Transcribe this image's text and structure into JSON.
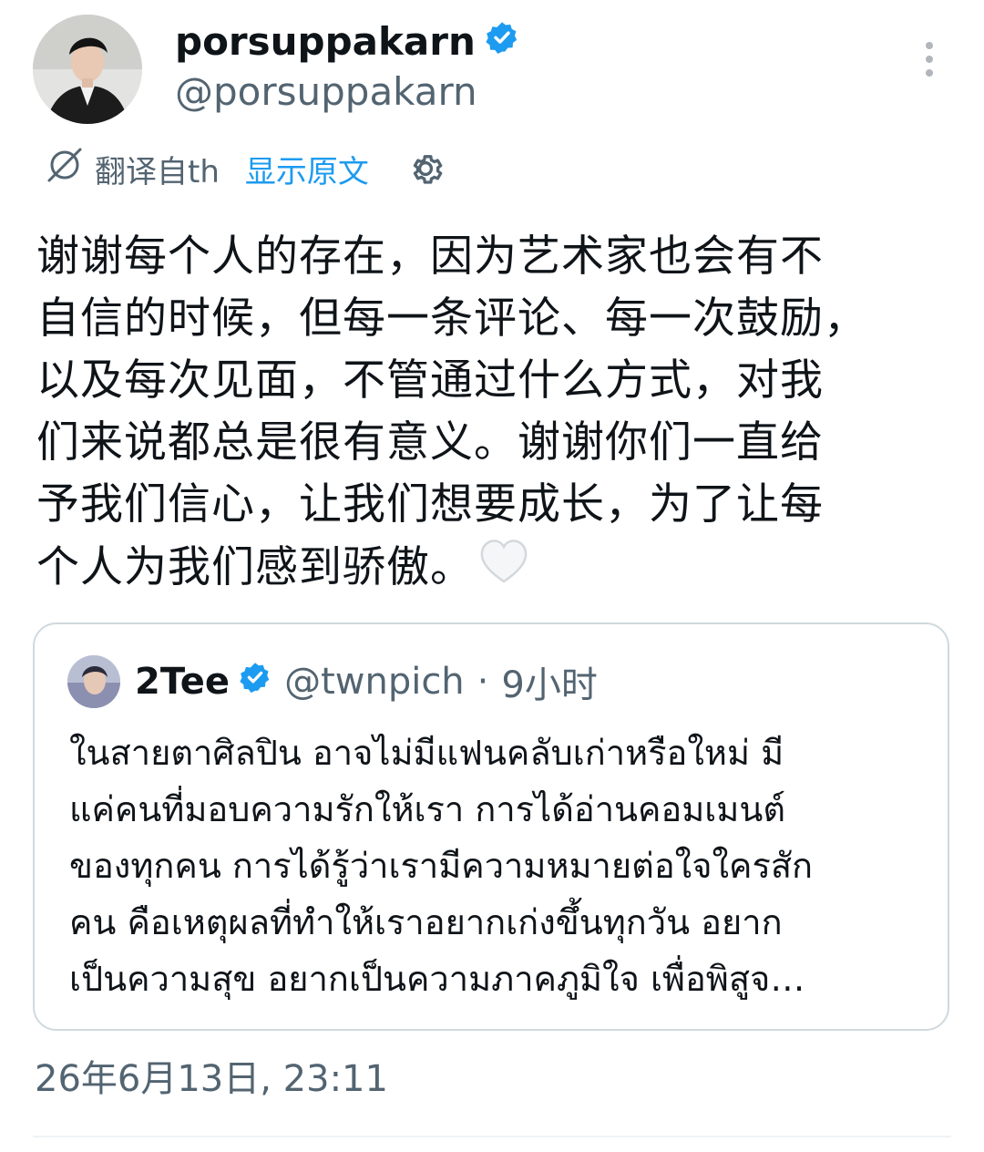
{
  "author": {
    "display_name": "porsuppakarn",
    "handle": "@porsuppakarn",
    "verified": true
  },
  "translation": {
    "label": "翻译自th",
    "show_original": "显示原文"
  },
  "tweet": {
    "text": "谢谢每个人的存在，因为艺术家也会有不\n自信的时候，但每一条评论、每一次鼓励，\n以及每次见面，不管通过什么方式，对我\n们来说都总是很有意义。谢谢你们一直给\n予我们信心，让我们想要成长，为了让每\n个人为我们感到骄傲。"
  },
  "quote": {
    "display_name": "2Tee",
    "handle": "@twnpich",
    "separator": "·",
    "time": "9小时",
    "text": "ในสายตาศิลปิน อาจไม่มีแฟนคลับเก่าหรือใหม่ มี\nแค่คนที่มอบความรักให้เรา การได้อ่านคอมเมนต์\nของทุกคน การได้รู้ว่าเรามีความหมายต่อใจใครสัก\nคน คือเหตุผลที่ทำให้เราอยากเก่งขึ้นทุกวัน อยาก\nเป็นความสุข อยากเป็นความภาคภูมิใจ เพื่อพิสูจ…"
  },
  "timestamp": "26年6月13日, 23:11",
  "colors": {
    "accent": "#1d9bf0",
    "secondary_text": "#536471",
    "border": "#cfd9de"
  }
}
